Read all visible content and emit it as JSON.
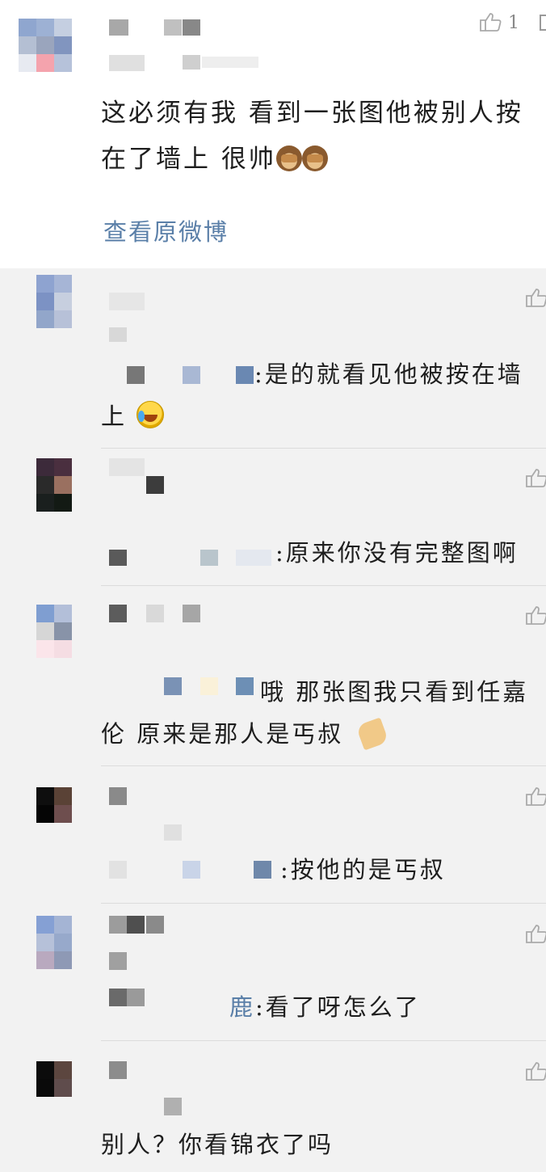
{
  "main_post": {
    "text": "这必须有我 看到一张图他被别人按在了墙上 很帅",
    "view_original_label": "查看原微博",
    "like_count": "1",
    "emojis": [
      "monkey-see-no-evil",
      "monkey-see-no-evil"
    ]
  },
  "comments": [
    {
      "text_suffix": ":是的就看见他被按在墙上",
      "emoji": "laughing-tears"
    },
    {
      "text_suffix": ":原来你没有完整图啊",
      "emoji": ""
    },
    {
      "text_suffix": "哦 那张图我只看到任嘉伦 原来是那人是丐叔",
      "emoji": "praying-hands"
    },
    {
      "text_suffix": ":按他的是丐叔",
      "emoji": ""
    },
    {
      "reply_name_visible": "鹿",
      "text_suffix": ":看了呀怎么了",
      "emoji": ""
    },
    {
      "text": "别人？你看锦衣了吗",
      "emoji": ""
    }
  ],
  "colors": {
    "background": "#f2f2f2",
    "card": "#ffffff",
    "link": "#5a7fa8",
    "text": "#1e1e1e",
    "icon": "#aaaaaa"
  },
  "icons": [
    "thumbs-up-icon",
    "more-icon"
  ]
}
